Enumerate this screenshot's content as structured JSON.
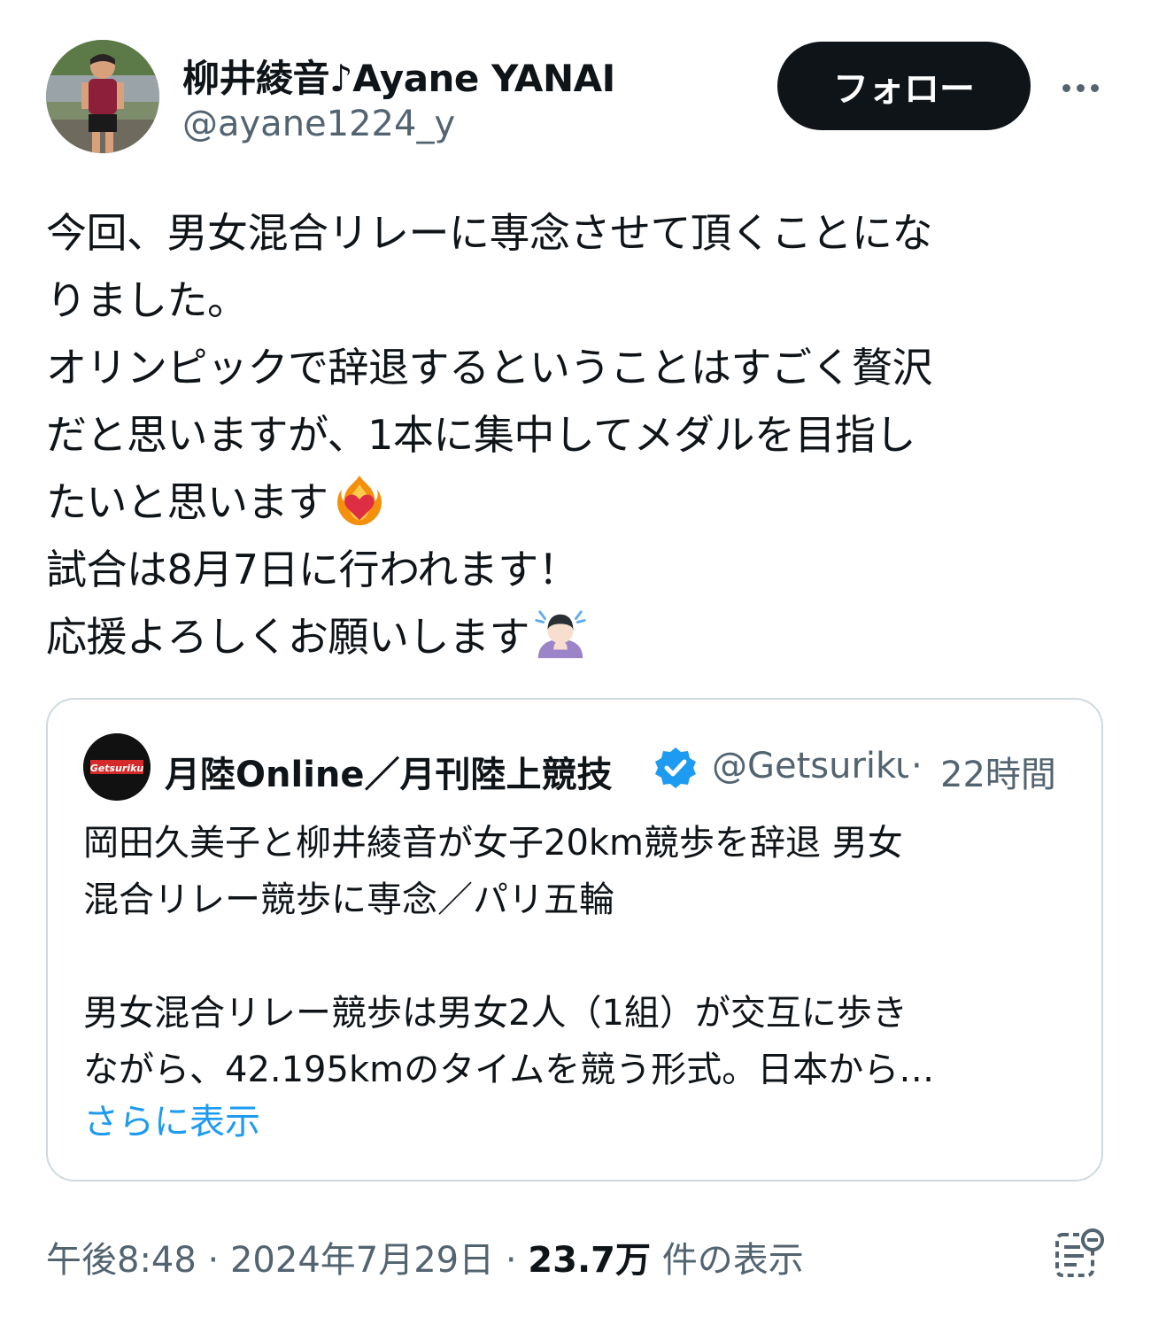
{
  "author": {
    "display_name": "柳井綾音♪Ayane YANAI",
    "handle": "@ayane1224_y",
    "follow_label": "フォロー"
  },
  "tweet": {
    "lines": [
      "今回、男女混合リレーに専念させて頂くことにな",
      "りました。",
      "オリンピックで辞退するということはすごく贅沢",
      "だと思いますが、1本に集中してメダルを目指し",
      "たいと思います",
      "試合は8月7日に行われます！",
      "応援よろしくお願いします"
    ],
    "emoji": [
      "heart-on-fire",
      "person-bowing"
    ]
  },
  "quote": {
    "name": "月陸Online／月刊陸上競技",
    "handle": "@Getsuriku",
    "separator": "·",
    "time": "22時間",
    "lines": [
      "岡田久美子と柳井綾音が女子20km競歩を辞退 男女",
      "混合リレー競歩に専念／パリ五輪",
      "",
      "男女混合リレー競歩は男女2人（1組）が交互に歩き",
      "ながら、42.195kmのタイムを競う形式。日本から…"
    ],
    "show_more": "さらに表示"
  },
  "footer": {
    "time": "午後8:48",
    "sep": "·",
    "date": "2024年7月29日",
    "views_count": "23.7万",
    "views_label": "件の表示"
  },
  "colors": {
    "text": "#0f1419",
    "secondary": "#536471",
    "link": "#1d9bf0",
    "border": "#cfd9de",
    "verified": "#1d9bf0"
  }
}
